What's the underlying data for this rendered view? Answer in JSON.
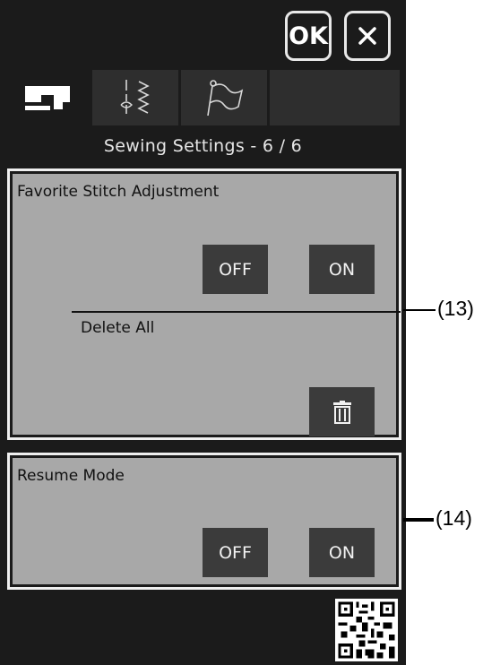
{
  "header": {
    "ok_label": "OK"
  },
  "tabs": [
    {
      "name": "machine-settings",
      "icon": "sewing-machine-icon",
      "active": true
    },
    {
      "name": "stitch-settings",
      "icon": "stitch-icon",
      "active": false
    },
    {
      "name": "general-settings",
      "icon": "flag-icon",
      "active": false
    }
  ],
  "page_title": "Sewing Settings  -  6 / 6",
  "favorite_stitch": {
    "label": "Favorite Stitch Adjustment",
    "off_label": "OFF",
    "on_label": "ON",
    "delete_all_label": "Delete All"
  },
  "resume_mode": {
    "label": "Resume Mode",
    "off_label": "OFF",
    "on_label": "ON"
  },
  "callouts": {
    "c13": "(13)",
    "c14": "(14)"
  },
  "colors": {
    "screen_bg": "#1b1b1b",
    "panel_bg": "#a8a8a8",
    "button_bg": "#3b3b3b",
    "frame": "#efefef"
  }
}
